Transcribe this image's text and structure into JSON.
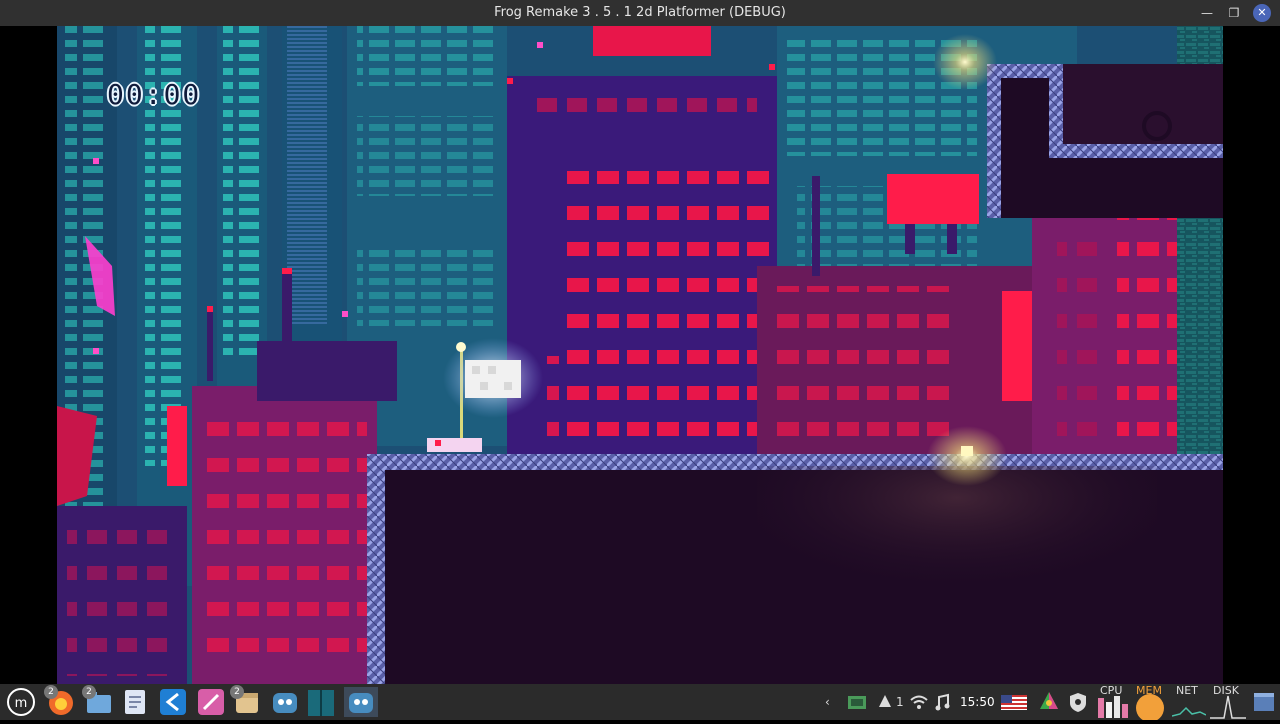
{
  "window": {
    "title": "Frog Remake 3 . 5 . 1 2d Platformer (DEBUG)",
    "minimize_glyph": "—",
    "maximize_glyph": "❐",
    "close_glyph": "✕"
  },
  "game": {
    "timer": "00:00"
  },
  "taskbar": {
    "apps": [
      {
        "name": "menu-icon",
        "badge": ""
      },
      {
        "name": "firefox-icon",
        "badge": "2"
      },
      {
        "name": "files-icon",
        "badge": "2"
      },
      {
        "name": "text-editor-icon",
        "badge": ""
      },
      {
        "name": "vscode-icon",
        "badge": ""
      },
      {
        "name": "drawing-icon",
        "badge": ""
      },
      {
        "name": "archive-icon",
        "badge": "2"
      },
      {
        "name": "godot-icon",
        "badge": ""
      },
      {
        "name": "terminal-icon",
        "badge": ""
      },
      {
        "name": "godot-debug-icon",
        "badge": ""
      }
    ],
    "tray": {
      "arrow": "‹",
      "notifications_count": "1",
      "clock": "15:50",
      "graph_labels": [
        "CPU",
        "MEM",
        "NET",
        "DISK"
      ]
    }
  },
  "colors": {
    "accent": "#4a66b8",
    "neon_red": "#ff1c4a",
    "teal": "#2bb3b0"
  }
}
